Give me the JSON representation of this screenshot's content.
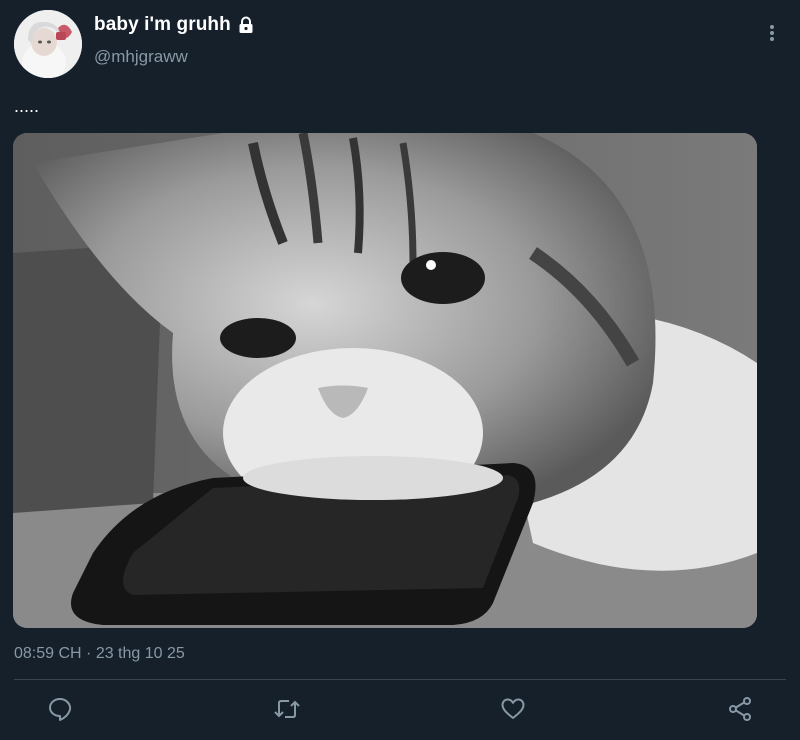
{
  "user": {
    "display_name": "baby i'm gruhh",
    "handle": "@mhjgraww",
    "avatar_icon": "profile-photo",
    "protected_icon": "lock-icon"
  },
  "tweet": {
    "text": ".....",
    "media_description": "grayscale photo of a sad tabby cat resting its chin on a phone",
    "timestamp": "08:59 CH · 23 thg 10 25"
  },
  "actions": {
    "reply_icon": "reply-icon",
    "retweet_icon": "retweet-icon",
    "like_icon": "heart-icon",
    "share_icon": "share-icon"
  },
  "colors": {
    "background": "#15202b",
    "secondary_text": "#8899a6",
    "divider": "#38444d",
    "icon": "#8899a6"
  }
}
